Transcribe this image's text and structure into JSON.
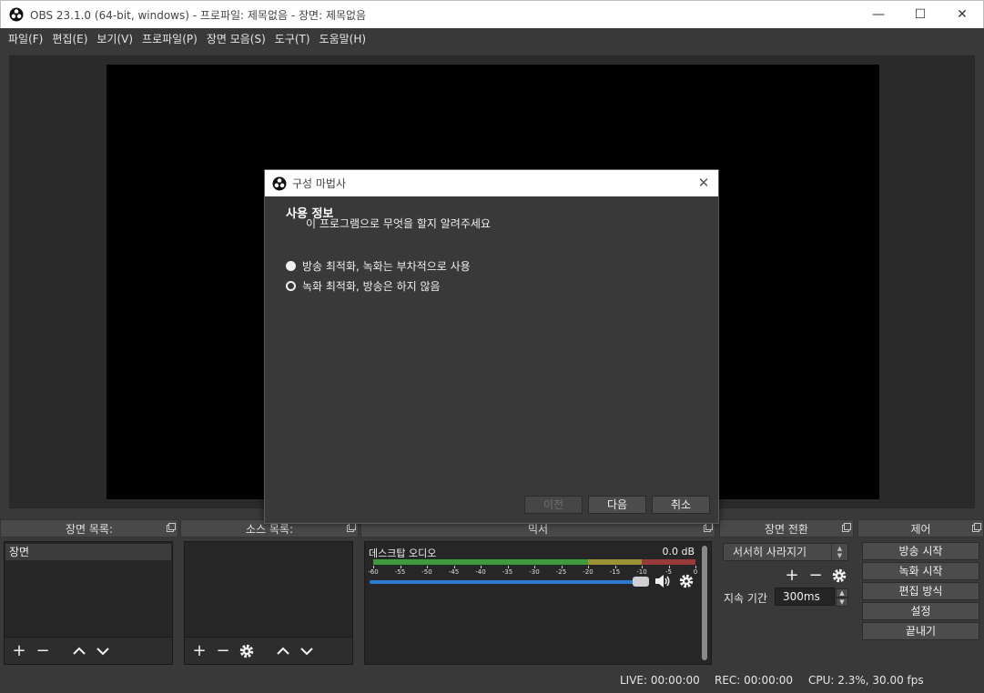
{
  "window": {
    "title": "OBS 23.1.0 (64-bit, windows) - 프로파일: 제목없음 - 장면: 제목없음",
    "minimize": "—",
    "maximize": "☐",
    "close": "✕"
  },
  "menu": [
    "파일(F)",
    "편집(E)",
    "보기(V)",
    "프로파일(P)",
    "장면 모음(S)",
    "도구(T)",
    "도움말(H)"
  ],
  "docks": {
    "scenes": {
      "title": "장면 목록:",
      "items": [
        "장면"
      ]
    },
    "sources": {
      "title": "소스 목록:"
    },
    "mixer": {
      "title": "믹서",
      "channel": "데스크탑 오디오",
      "level": "0.0 dB",
      "scale": [
        "-60",
        "-55",
        "-50",
        "-45",
        "-40",
        "-35",
        "-30",
        "-25",
        "-20",
        "-15",
        "-10",
        "-5",
        "0"
      ]
    },
    "transitions": {
      "title": "장면 전환",
      "selected": "서서히 사라지기",
      "duration_label": "지속 기간",
      "duration": "300ms"
    },
    "controls": {
      "title": "제어",
      "buttons": [
        "방송 시작",
        "녹화 시작",
        "편집 방식",
        "설정",
        "끝내기"
      ]
    }
  },
  "status": {
    "live": "LIVE: 00:00:00",
    "rec": "REC: 00:00:00",
    "cpu": "CPU: 2.3%, 30.00 fps"
  },
  "dialog": {
    "title": "구성 마법사",
    "heading": "사용 정보",
    "subheading": "이 프로그램으로 무엇을 할지 알려주세요",
    "options": [
      {
        "label": "방송 최적화, 녹화는 부차적으로 사용",
        "checked": true
      },
      {
        "label": "녹화 최적화, 방송은 하지 않음",
        "checked": false
      }
    ],
    "buttons": {
      "prev": "이전",
      "next": "다음",
      "cancel": "취소"
    }
  },
  "colors": {
    "accent": "#2f7ad1",
    "meter_green": "#3f9a3c",
    "meter_yellow": "#9b9236",
    "meter_red": "#9a3b3b"
  }
}
